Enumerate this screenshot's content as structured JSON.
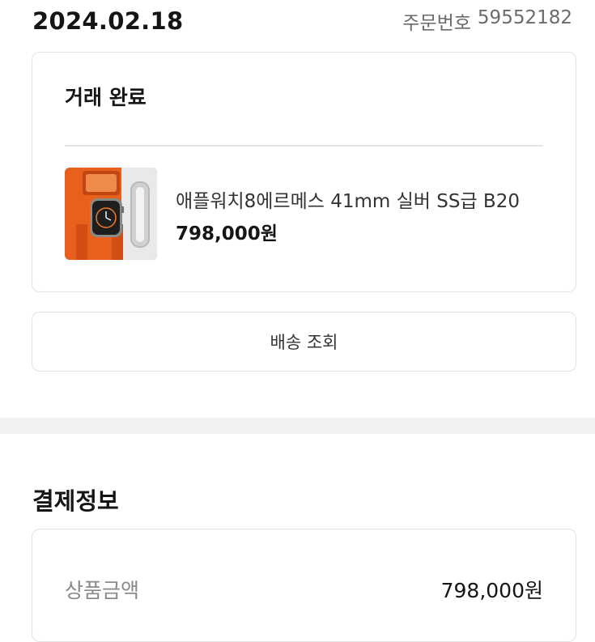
{
  "header": {
    "date": "2024.02.18",
    "order_number_label": "주문번호",
    "order_number": "59552182"
  },
  "status_card": {
    "status": "거래 완료",
    "product": {
      "name": "애플워치8에르메스 41mm 실버 SS급 B20",
      "price": "798,000원",
      "thumbnail": "apple-watch-hermes-photo"
    }
  },
  "track_button_label": "배송 조회",
  "payment": {
    "title": "결제정보",
    "rows": [
      {
        "label": "상품금액",
        "value": "798,000원"
      }
    ]
  },
  "colors": {
    "thumb_orange": "#e8601c",
    "border": "#e3e3e3",
    "section_gap": "#f2f2f2"
  }
}
